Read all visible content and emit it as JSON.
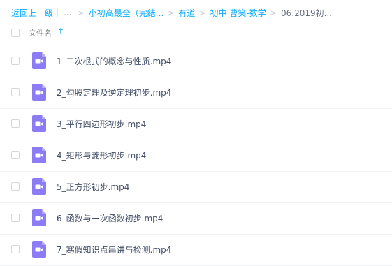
{
  "breadcrumb": {
    "back_label": "返回上一级",
    "divider": "|",
    "ellipsis": "...",
    "items": [
      "小初高最全（完结...",
      "有道",
      "初中 曹笑-数学",
      "06.2019初..."
    ]
  },
  "file_list": {
    "header": {
      "name_label": "文件名",
      "sort_indicator": "↑"
    },
    "files": [
      {
        "name": "1_二次根式的概念与性质.mp4",
        "icon": "video-file-icon"
      },
      {
        "name": "2_勾股定理及逆定理初步.mp4",
        "icon": "video-file-icon"
      },
      {
        "name": "3_平行四边形初步.mp4",
        "icon": "video-file-icon"
      },
      {
        "name": "4_矩形与菱形初步.mp4",
        "icon": "video-file-icon"
      },
      {
        "name": "5_正方形初步.mp4",
        "icon": "video-file-icon"
      },
      {
        "name": "6_函数与一次函数初步.mp4",
        "icon": "video-file-icon"
      },
      {
        "name": "7_寒假知识点串讲与检测.mp4",
        "icon": "video-file-icon"
      }
    ]
  },
  "colors": {
    "link": "#09aaff",
    "icon_bg": "#8b7cf6",
    "text": "#424e67"
  }
}
